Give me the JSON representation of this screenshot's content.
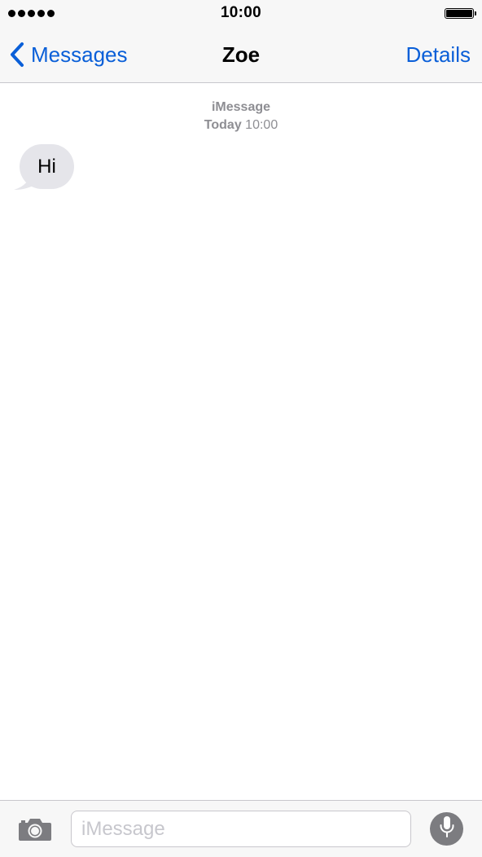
{
  "status_bar": {
    "time": "10:00",
    "signal_icon": "signal-dots-icon",
    "battery_icon": "battery-full-icon"
  },
  "nav": {
    "back_label": "Messages",
    "back_icon": "chevron-left-icon",
    "title": "Zoe",
    "details_label": "Details"
  },
  "conversation": {
    "service_label": "iMessage",
    "day_label": "Today",
    "time_label": "10:00",
    "messages": [
      {
        "direction": "incoming",
        "text": "Hi"
      }
    ]
  },
  "composer": {
    "camera_icon": "camera-icon",
    "input_value": "",
    "input_placeholder": "iMessage",
    "mic_icon": "microphone-icon"
  },
  "colors": {
    "accent": "#0a5fd8",
    "bubble_incoming": "#e5e5ea",
    "meta_text": "#8e8e93",
    "bar_background": "#f7f7f7"
  }
}
